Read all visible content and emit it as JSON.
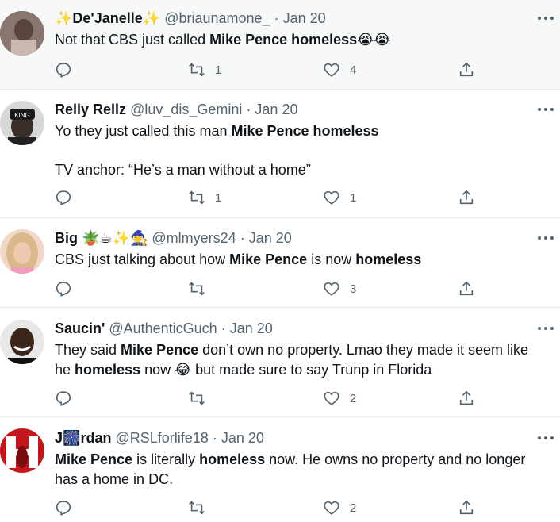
{
  "tweets": [
    {
      "name_prefix": "✨",
      "name": "De'Janelle",
      "name_suffix": "✨",
      "handle": "@briaunamone_",
      "date": "Jan 20",
      "text_1": "Not that CBS just called ",
      "bold_1": "Mike Pence homeless",
      "emoji_1": "😭",
      "emoji_2": "😭",
      "retweets": "1",
      "likes": "4"
    },
    {
      "name": "Relly Rellz",
      "handle": "@luv_dis_Gemini",
      "date": "Jan 20",
      "avatar_cap_text": "KING",
      "text_1": "Yo they just called this man ",
      "bold_1": "Mike Pence homeless",
      "line_2": "TV anchor: “He’s a man without a home”",
      "retweets": "1",
      "likes": "1"
    },
    {
      "name": "Big",
      "name_emojis": "🪴☕✨🧙‍♀️",
      "handle": "@mlmyers24",
      "date": "Jan 20",
      "text_1": "CBS just talking about how ",
      "bold_1": "Mike Pence",
      "text_2": " is now ",
      "bold_2": "homeless",
      "retweets": "",
      "likes": "3"
    },
    {
      "name": "Saucin'",
      "handle": "@AuthenticGuch",
      "date": "Jan 20",
      "text_1": "They said ",
      "bold_1": "Mike Pence",
      "text_2": " don’t own no property. Lmao they made it seem like",
      "text_3": "he ",
      "bold_2": "homeless",
      "text_4": " now ",
      "emoji_1": "😂",
      "text_5": " but made sure to say Trunp in Florida",
      "retweets": "",
      "likes": "2"
    },
    {
      "name_1": "J",
      "name_emoji": "🎆",
      "name_2": "rdan",
      "handle": "@RSLforlife18",
      "date": "Jan 20",
      "bold_1": "Mike Pence",
      "text_1": " is literally ",
      "bold_2": "homeless",
      "text_2": " now. He owns no property and no longer",
      "text_3": "has a home in DC.",
      "retweets": "",
      "likes": "2"
    }
  ],
  "separator": "·",
  "colors": {
    "text": "#0f1419",
    "secondary": "#536471",
    "divider": "#e6ecf0",
    "highlight_bg": "#f7f9f9"
  },
  "icons": [
    "reply-icon",
    "retweet-icon",
    "like-icon",
    "share-icon",
    "more-icon"
  ]
}
